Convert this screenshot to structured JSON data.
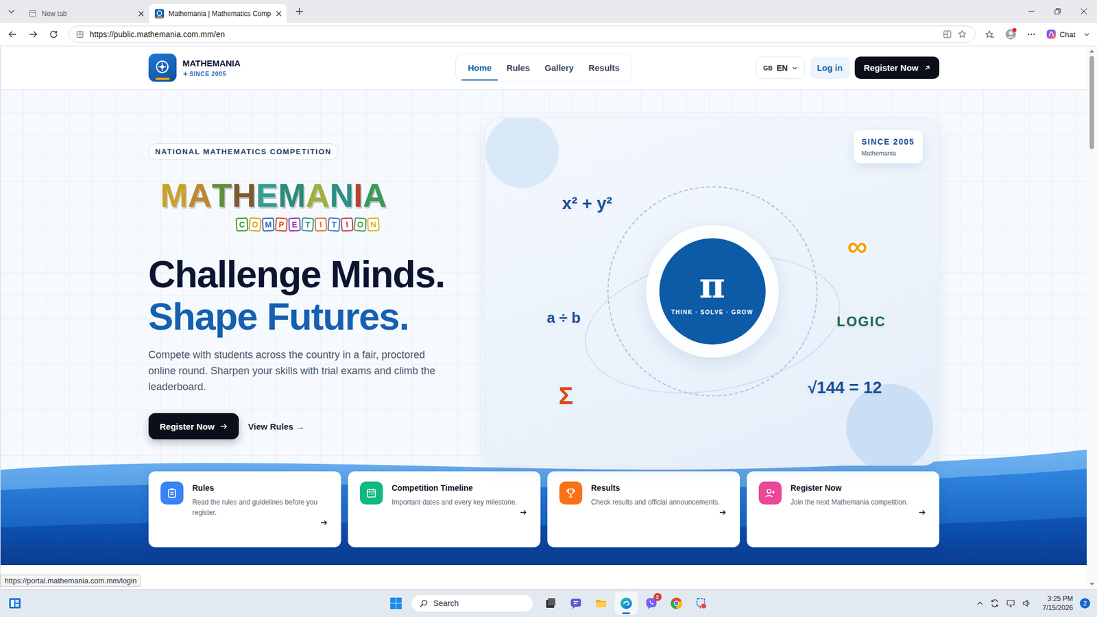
{
  "browser": {
    "tabs": [
      {
        "title": "New tab",
        "selected": false
      },
      {
        "title": "Mathemania | Mathematics Comp",
        "selected": true
      }
    ],
    "url": "https://public.mathemania.com.mm/en",
    "profile_alert": true,
    "chat": "Chat",
    "status_link": "https://portal.mathemania.com.mm/login"
  },
  "site": {
    "brand": {
      "name": "MATHEMANIA",
      "since": "SINCE 2005"
    },
    "nav": [
      {
        "label": "Home",
        "selected": true
      },
      {
        "label": "Rules",
        "selected": false
      },
      {
        "label": "Gallery",
        "selected": false
      },
      {
        "label": "Results",
        "selected": false
      }
    ],
    "language": {
      "flag": "GB",
      "code": "EN"
    },
    "login": "Log in",
    "register": "Register Now"
  },
  "hero": {
    "badge": "NATIONAL MATHEMATICS COMPETITION",
    "logo_word": [
      {
        "char": "M",
        "color": "#c9a227"
      },
      {
        "char": "A",
        "color": "#c0862c"
      },
      {
        "char": "T",
        "color": "#5b8f3a"
      },
      {
        "char": "H",
        "color": "#7a5a2e"
      },
      {
        "char": "E",
        "color": "#2f9e8f"
      },
      {
        "char": "M",
        "color": "#2b8c78"
      },
      {
        "char": "A",
        "color": "#9fb03a"
      },
      {
        "char": "N",
        "color": "#2e8f86"
      },
      {
        "char": "I",
        "color": "#b5442f"
      },
      {
        "char": "A",
        "color": "#3a9a5a"
      }
    ],
    "logo_sub": [
      {
        "char": "C",
        "color": "#3a9a3a"
      },
      {
        "char": "O",
        "color": "#e0a020"
      },
      {
        "char": "M",
        "color": "#2a6ac0"
      },
      {
        "char": "P",
        "color": "#d04a2a"
      },
      {
        "char": "E",
        "color": "#8a3ab0"
      },
      {
        "char": "T",
        "color": "#2a9a8a"
      },
      {
        "char": "I",
        "color": "#e07020"
      },
      {
        "char": "T",
        "color": "#3a7ad0"
      },
      {
        "char": "I",
        "color": "#c03a5a"
      },
      {
        "char": "O",
        "color": "#4aa04a"
      },
      {
        "char": "N",
        "color": "#e0b020"
      }
    ],
    "headline": [
      {
        "text": "Challenge Minds.",
        "color": "#0b1530"
      },
      {
        "text": "Shape Futures.",
        "color": "#1560b0"
      }
    ],
    "text": "Compete with students across the country in a fair, proctored online round. Sharpen your skills with trial exams and climb the leaderboard.",
    "primary_button": "Register Now",
    "secondary_button": "View Rules →"
  },
  "visual": {
    "since": {
      "title": "SINCE 2005",
      "subtitle": "Mathemania"
    },
    "symbol": "π",
    "tagline": "THINK · SOLVE · GROW",
    "floats": [
      {
        "text": "x² + y²",
        "color": "#1b4f9a"
      },
      {
        "text": "∞",
        "color": "#f5a30b"
      },
      {
        "text": "a ÷ b",
        "color": "#1b4f9a"
      },
      {
        "text": "LOGIC",
        "color": "#0f6b4a"
      },
      {
        "text": "Σ",
        "color": "#d9480f"
      },
      {
        "text": "√144 = 12",
        "color": "#1b4f9a"
      }
    ]
  },
  "features": [
    {
      "kind": "clipboard",
      "title": "Rules",
      "text": "Read the rules and guidelines before you register.",
      "color": "#3b82f6"
    },
    {
      "kind": "calendar",
      "title": "Competition Timeline",
      "text": "Important dates and every key milestone.",
      "color": "#10b981"
    },
    {
      "kind": "trophy",
      "title": "Results",
      "text": "Check results and official announcements.",
      "color": "#f97316"
    },
    {
      "kind": "adduser",
      "title": "Register Now",
      "text": "Join the next Mathemania competition.",
      "color": "#ec4899"
    }
  ],
  "taskbar": {
    "search": "Search",
    "apps": [
      {
        "kind": "taskview",
        "active": false
      },
      {
        "kind": "teams",
        "active": false
      },
      {
        "kind": "files",
        "active": false
      },
      {
        "kind": "edge",
        "active": true
      },
      {
        "kind": "viber",
        "active": false,
        "badge": "2"
      },
      {
        "kind": "chrome",
        "active": false
      },
      {
        "kind": "snip",
        "active": false
      }
    ],
    "time": "3:25 PM",
    "date": "7/15/2026",
    "notifications": "2"
  }
}
